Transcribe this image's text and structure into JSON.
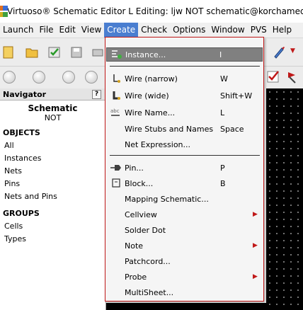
{
  "window": {
    "title": "Virtuoso® Schematic Editor L Editing: ljw NOT schematic@korchamedu"
  },
  "menubar": {
    "items": [
      "Launch",
      "File",
      "Edit",
      "View",
      "Create",
      "Check",
      "Options",
      "Window",
      "PVS",
      "Help"
    ],
    "active": "Create"
  },
  "navigator": {
    "title": "Navigator",
    "help": "?",
    "view_title": "Schematic",
    "view_sub": "NOT",
    "objects_label": "OBJECTS",
    "objects": [
      "All",
      "Instances",
      "Nets",
      "Pins",
      "Nets and Pins"
    ],
    "groups_label": "GROUPS",
    "groups": [
      "Cells",
      "Types"
    ]
  },
  "create_menu": {
    "items": [
      {
        "label": "Instance...",
        "shortcut": "I",
        "icon": "instance-icon",
        "highlight": true
      },
      {
        "label": "Wire (narrow)",
        "shortcut": "W",
        "icon": "wire-narrow-icon"
      },
      {
        "label": "Wire (wide)",
        "shortcut": "Shift+W",
        "icon": "wire-wide-icon"
      },
      {
        "label": "Wire Name...",
        "shortcut": "L",
        "icon": "wire-name-icon"
      },
      {
        "label": "Wire Stubs and Names",
        "shortcut": "Space"
      },
      {
        "label": "Net Expression..."
      },
      {
        "label": "Pin...",
        "shortcut": "P",
        "icon": "pin-icon"
      },
      {
        "label": "Block...",
        "shortcut": "B",
        "icon": "block-icon"
      },
      {
        "label": "Mapping Schematic..."
      },
      {
        "label": "Cellview",
        "submenu": true
      },
      {
        "label": "Solder Dot"
      },
      {
        "label": "Note",
        "submenu": true
      },
      {
        "label": "Patchcord..."
      },
      {
        "label": "Probe",
        "submenu": true
      },
      {
        "label": "MultiSheet..."
      }
    ]
  },
  "colors": {
    "menu_active": "#4a7ed0",
    "menu_border": "#c01818",
    "highlight": "#808080",
    "canvas": "#000000"
  }
}
